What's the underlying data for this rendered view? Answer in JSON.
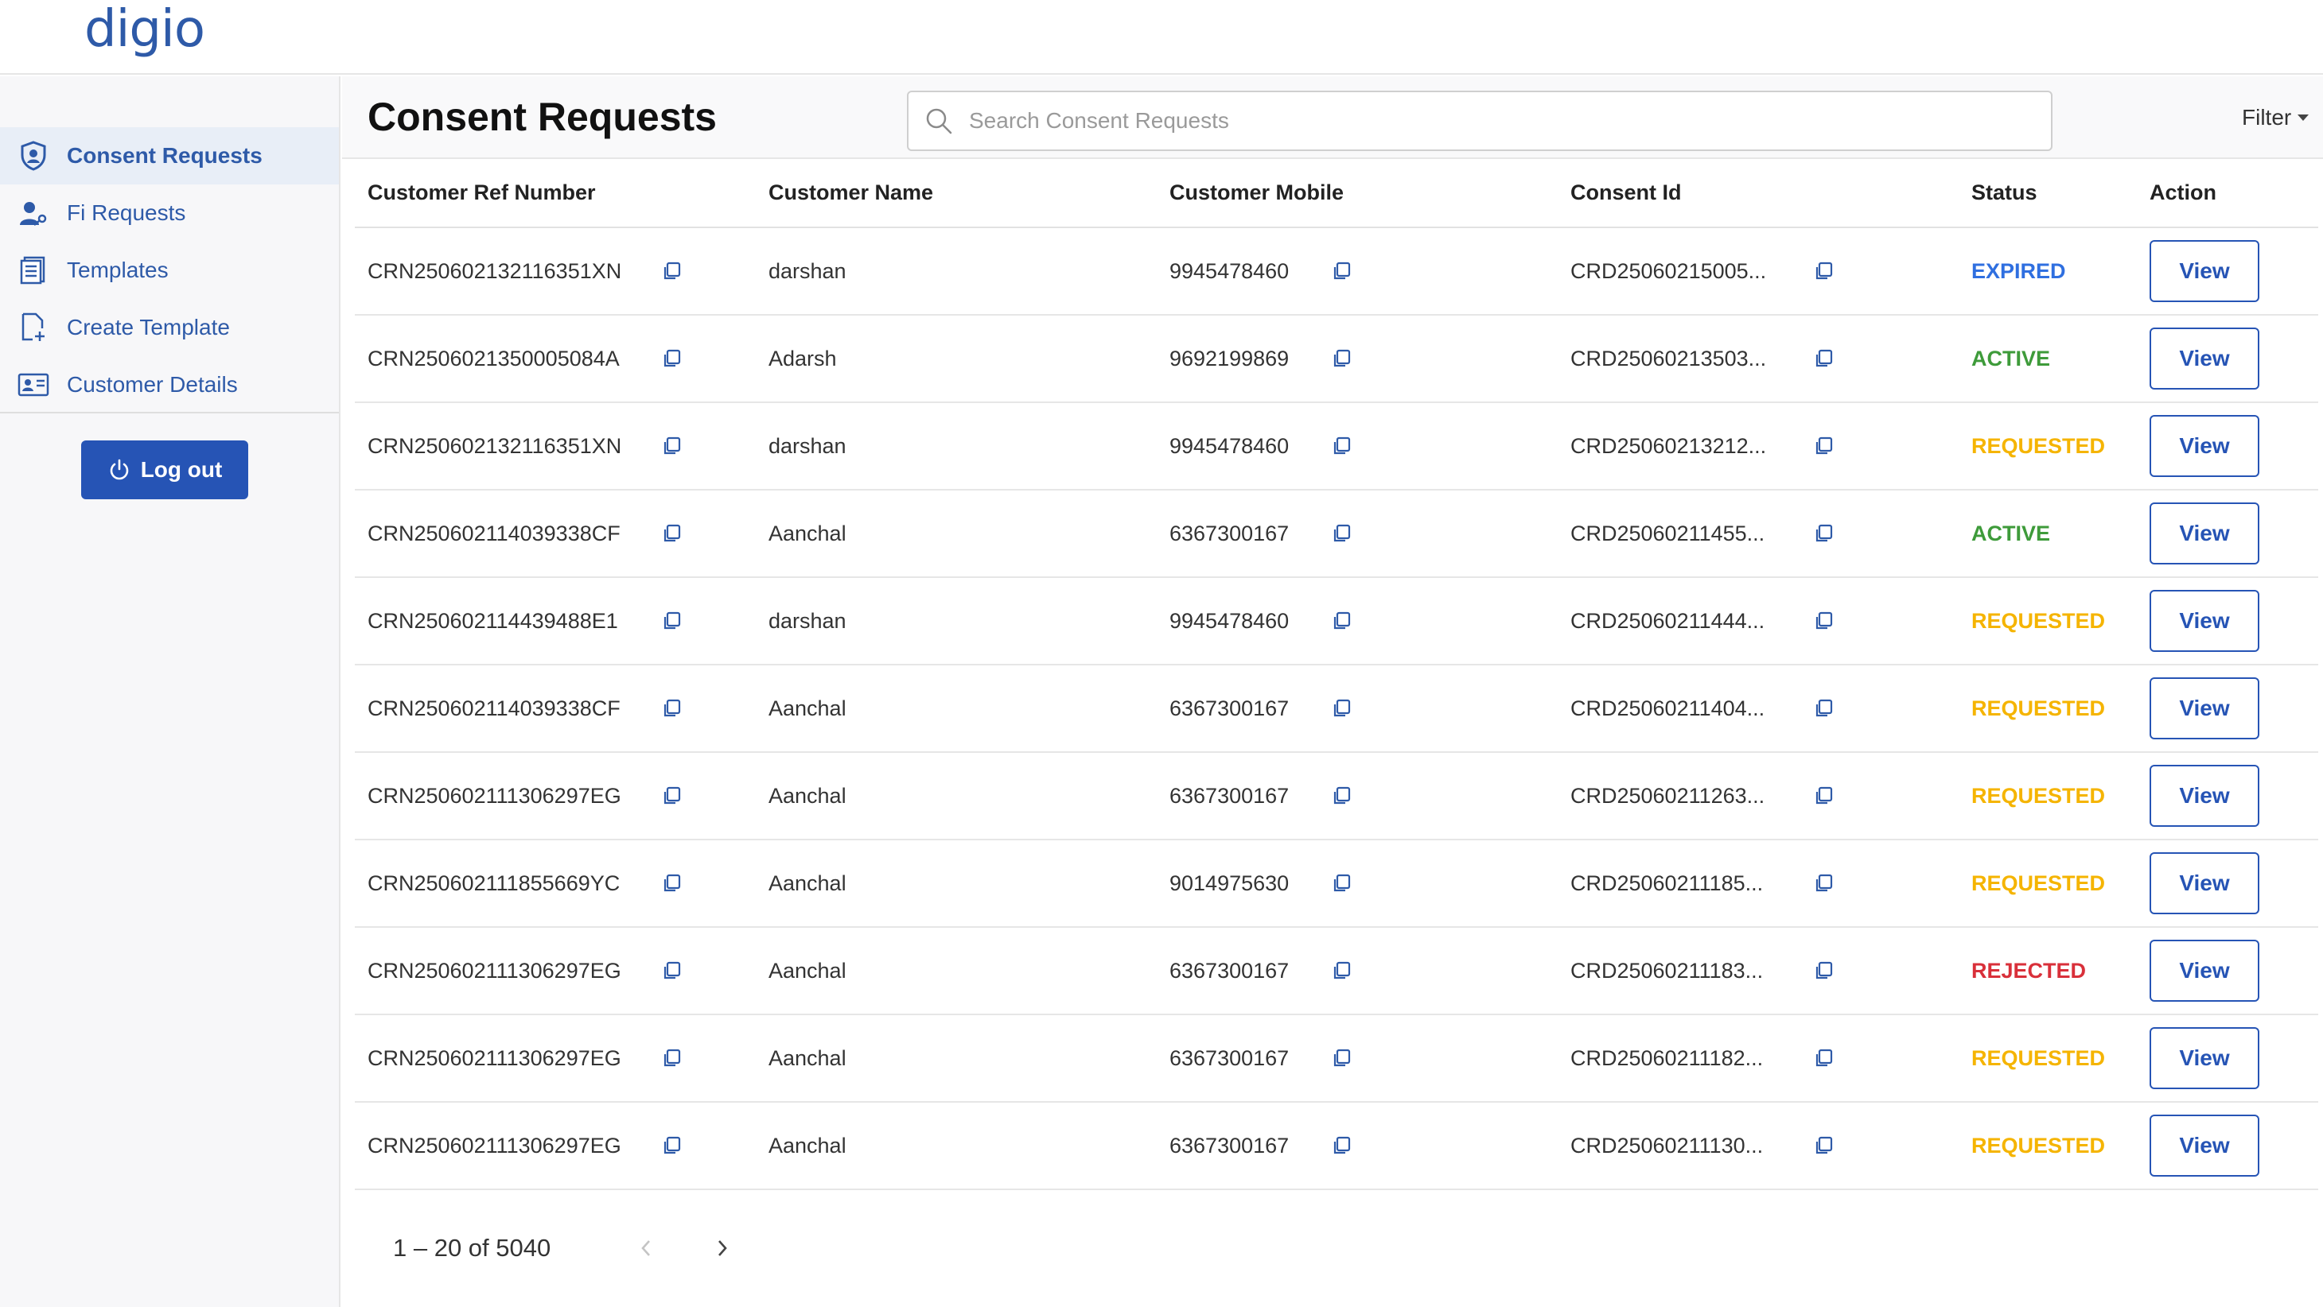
{
  "app": {
    "logo": "digio"
  },
  "sidebar": {
    "items": [
      {
        "label": "Consent Requests",
        "icon": "shield-person-icon",
        "active": true
      },
      {
        "label": "Fi Requests",
        "icon": "user-key-icon",
        "active": false
      },
      {
        "label": "Templates",
        "icon": "document-list-icon",
        "active": false
      },
      {
        "label": "Create Template",
        "icon": "add-document-icon",
        "active": false
      },
      {
        "label": "Customer Details",
        "icon": "id-card-icon",
        "active": false
      }
    ],
    "logout_label": "Log out"
  },
  "header": {
    "title": "Consent Requests",
    "search_placeholder": "Search Consent Requests",
    "filter_label": "Filter"
  },
  "table": {
    "columns": [
      "Customer Ref Number",
      "Customer Name",
      "Customer Mobile",
      "Consent Id",
      "Status",
      "Action"
    ],
    "action_label": "View",
    "rows": [
      {
        "ref": "CRN250602132116351XN",
        "name": "darshan",
        "mobile": "9945478460",
        "consent": "CRD25060215005...",
        "status": "EXPIRED"
      },
      {
        "ref": "CRN2506021350005084A",
        "name": "Adarsh",
        "mobile": "9692199869",
        "consent": "CRD25060213503...",
        "status": "ACTIVE"
      },
      {
        "ref": "CRN250602132116351XN",
        "name": "darshan",
        "mobile": "9945478460",
        "consent": "CRD25060213212...",
        "status": "REQUESTED"
      },
      {
        "ref": "CRN250602114039338CF",
        "name": "Aanchal",
        "mobile": "6367300167",
        "consent": "CRD25060211455...",
        "status": "ACTIVE"
      },
      {
        "ref": "CRN250602114439488E1",
        "name": "darshan",
        "mobile": "9945478460",
        "consent": "CRD25060211444...",
        "status": "REQUESTED"
      },
      {
        "ref": "CRN250602114039338CF",
        "name": "Aanchal",
        "mobile": "6367300167",
        "consent": "CRD25060211404...",
        "status": "REQUESTED"
      },
      {
        "ref": "CRN250602111306297EG",
        "name": "Aanchal",
        "mobile": "6367300167",
        "consent": "CRD25060211263...",
        "status": "REQUESTED"
      },
      {
        "ref": "CRN250602111855669YC",
        "name": "Aanchal",
        "mobile": "9014975630",
        "consent": "CRD25060211185...",
        "status": "REQUESTED"
      },
      {
        "ref": "CRN250602111306297EG",
        "name": "Aanchal",
        "mobile": "6367300167",
        "consent": "CRD25060211183...",
        "status": "REJECTED"
      },
      {
        "ref": "CRN250602111306297EG",
        "name": "Aanchal",
        "mobile": "6367300167",
        "consent": "CRD25060211182...",
        "status": "REQUESTED"
      },
      {
        "ref": "CRN250602111306297EG",
        "name": "Aanchal",
        "mobile": "6367300167",
        "consent": "CRD25060211130...",
        "status": "REQUESTED"
      }
    ]
  },
  "status_colors": {
    "EXPIRED": "#2f6fe0",
    "ACTIVE": "#3e9b3a",
    "REQUESTED": "#f5b400",
    "REJECTED": "#d9303a"
  },
  "pagination": {
    "range_text": "1 – 20 of 5040"
  },
  "colors": {
    "primary": "#2654b5",
    "accent_text": "#2e5aa8"
  }
}
